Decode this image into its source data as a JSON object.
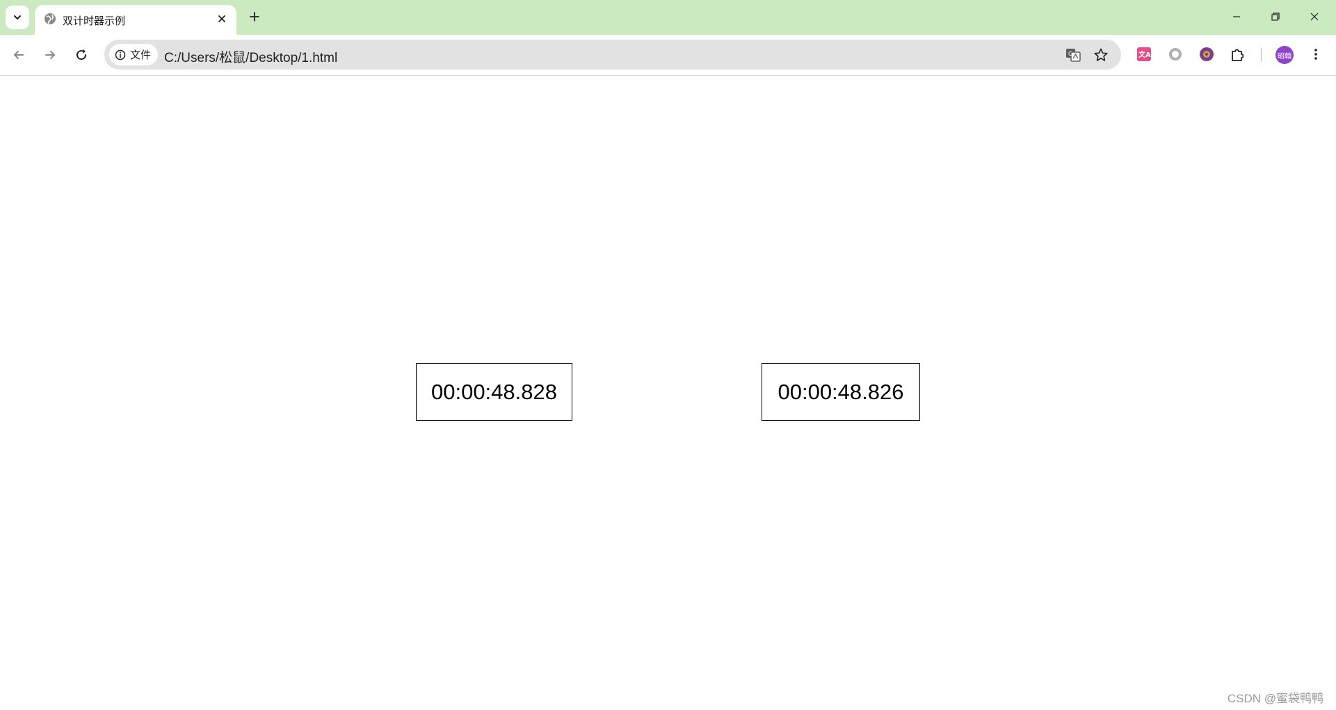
{
  "browser": {
    "tab": {
      "title": "双计时器示例"
    },
    "toolbar": {
      "site_info_label": "文件",
      "url": "C:/Users/松鼠/Desktop/1.html",
      "avatar_text": "昭翰"
    },
    "colors": {
      "tabstrip_bg": "#cbeac0",
      "omnibox_bg": "#e2e2e2",
      "avatar_bg": "#8e44c9"
    },
    "icons": {
      "tab_search": "chevron-down-icon",
      "favicon": "globe-icon",
      "tab_close": "close-icon",
      "new_tab": "plus-icon",
      "back": "back-arrow-icon",
      "forward": "forward-arrow-icon",
      "reload": "reload-icon",
      "site_info": "info-icon",
      "translate": "translate-icon",
      "bookmark": "star-icon",
      "extensions": [
        "translate-extension-icon",
        "circle-extension-icon",
        "bug-extension-icon",
        "puzzle-icon"
      ],
      "menu": "kebab-menu-icon",
      "minimize": "minimize-icon",
      "restore": "restore-icon",
      "close_window": "close-window-icon"
    }
  },
  "page": {
    "timers": [
      {
        "value": "00:00:48.828"
      },
      {
        "value": "00:00:48.826"
      }
    ],
    "watermark": "CSDN @蜜袋鸭鸭"
  }
}
